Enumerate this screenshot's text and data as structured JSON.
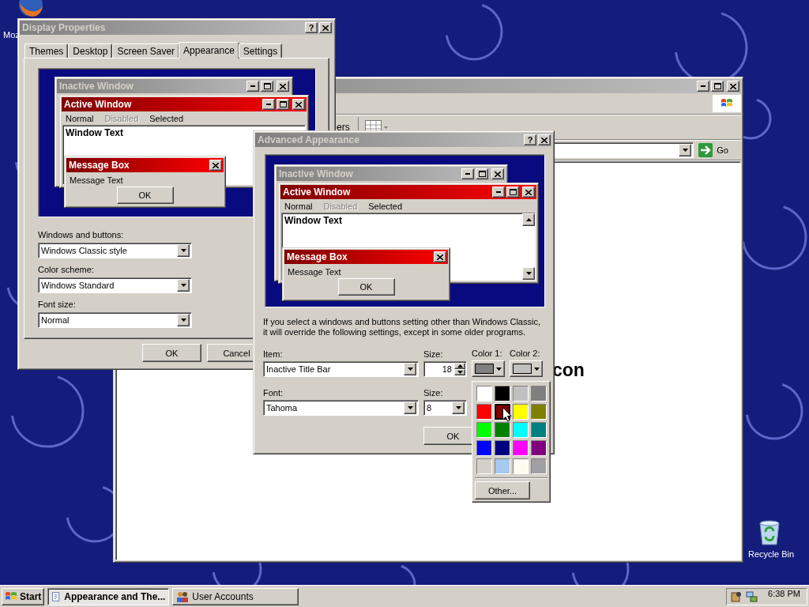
{
  "desktop_icons": [
    {
      "label": "Moz"
    },
    {
      "label": "Recycle Bin"
    }
  ],
  "explorer_window": {
    "active": false,
    "toolbar_text": "ers",
    "go_button": "Go",
    "content_text": "con"
  },
  "display_properties": {
    "title": "Display Properties",
    "active": false,
    "help": "?",
    "tabs": [
      {
        "label": "Themes",
        "selected": false
      },
      {
        "label": "Desktop",
        "selected": false
      },
      {
        "label": "Screen Saver",
        "selected": false
      },
      {
        "label": "Appearance",
        "selected": true
      },
      {
        "label": "Settings",
        "selected": false
      }
    ],
    "preview": {
      "inactive_title": "Inactive Window",
      "active_title": "Active Window",
      "menu": [
        {
          "label": "Normal",
          "kind": "normal"
        },
        {
          "label": "Disabled",
          "kind": "disabled"
        },
        {
          "label": "Selected",
          "kind": "selected"
        }
      ],
      "window_text": "Window Text",
      "message_title": "Message Box",
      "message_text": "Message Text",
      "ok": "OK"
    },
    "fields": [
      {
        "label": "Windows and buttons:",
        "value": "Windows Classic style"
      },
      {
        "label": "Color scheme:",
        "value": "Windows Standard"
      },
      {
        "label": "Font size:",
        "value": "Normal"
      }
    ],
    "buttons": [
      "OK",
      "Cancel"
    ]
  },
  "advanced_appearance": {
    "title": "Advanced Appearance",
    "active": false,
    "help": "?",
    "preview": {
      "inactive_title": "Inactive Window",
      "active_title": "Active Window",
      "menu": [
        {
          "label": "Normal",
          "kind": "normal"
        },
        {
          "label": "Disabled",
          "kind": "disabled"
        },
        {
          "label": "Selected",
          "kind": "selected"
        }
      ],
      "window_text": "Window Text",
      "message_title": "Message Box",
      "message_text": "Message Text",
      "ok": "OK"
    },
    "note": "If you select a windows and buttons setting other than Windows Classic, it will override the following settings, except in some older programs.",
    "item": {
      "label": "Item:",
      "value": "Inactive Title Bar"
    },
    "item_size": {
      "label": "Size:",
      "value": "18"
    },
    "color_1": {
      "label": "Color 1:",
      "color": "#808080"
    },
    "color_2": {
      "label": "Color 2:",
      "color": "#c0c0c0"
    },
    "font": {
      "label": "Font:",
      "value": "Tahoma"
    },
    "font_size": {
      "label": "Size:",
      "value": "8"
    },
    "buttons": [
      "OK"
    ]
  },
  "color_menu": {
    "swatches": [
      {
        "color": "#ffffff",
        "selected": false
      },
      {
        "color": "#000000",
        "selected": false
      },
      {
        "color": "#c0c0c0",
        "selected": false
      },
      {
        "color": "#808080",
        "selected": false
      },
      {
        "color": "#ff0000",
        "selected": false
      },
      {
        "color": "#800000",
        "selected": true
      },
      {
        "color": "#ffff00",
        "selected": false
      },
      {
        "color": "#808000",
        "selected": false
      },
      {
        "color": "#00ff00",
        "selected": false
      },
      {
        "color": "#008000",
        "selected": false
      },
      {
        "color": "#00ffff",
        "selected": false
      },
      {
        "color": "#008080",
        "selected": false
      },
      {
        "color": "#0000ff",
        "selected": false
      },
      {
        "color": "#000080",
        "selected": false
      },
      {
        "color": "#ff00ff",
        "selected": false
      },
      {
        "color": "#800080",
        "selected": false
      },
      {
        "color": "#d4d0c8",
        "selected": false
      },
      {
        "color": "#a6caf0",
        "selected": false
      },
      {
        "color": "#fffbf0",
        "selected": false
      },
      {
        "color": "#a0a0a4",
        "selected": false
      }
    ],
    "other_button": "Other..."
  },
  "taskbar": {
    "start": "Start",
    "tasks": [
      {
        "label": "Appearance and The...",
        "selected": true
      },
      {
        "label": "User Accounts",
        "selected": false
      }
    ],
    "clock": "6:38 PM"
  }
}
